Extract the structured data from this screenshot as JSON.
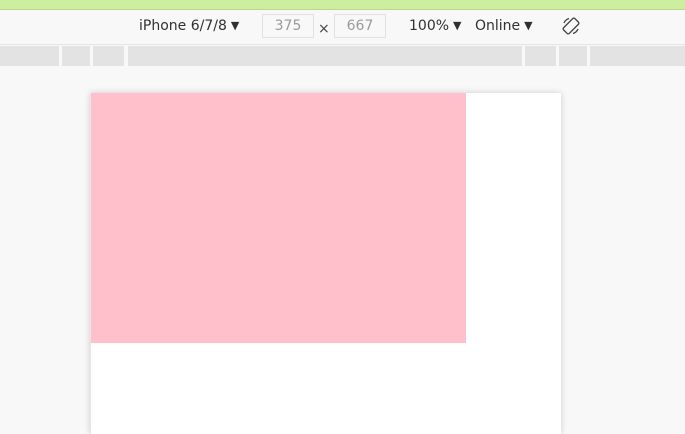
{
  "toolbar": {
    "device_label": "iPhone 6/7/8",
    "caret_glyph": "▼",
    "width_value": "375",
    "height_value": "667",
    "times_glyph": "×",
    "zoom_label": "100%",
    "network_label": "Online",
    "rotate_icon": "rotate-icon"
  },
  "colors": {
    "top_strip": "#cdeea0",
    "pink_box": "#ffc0cb",
    "ruler_segment": "#e3e3e3"
  },
  "viewport": {
    "element_fill": "#ffc0cb"
  }
}
